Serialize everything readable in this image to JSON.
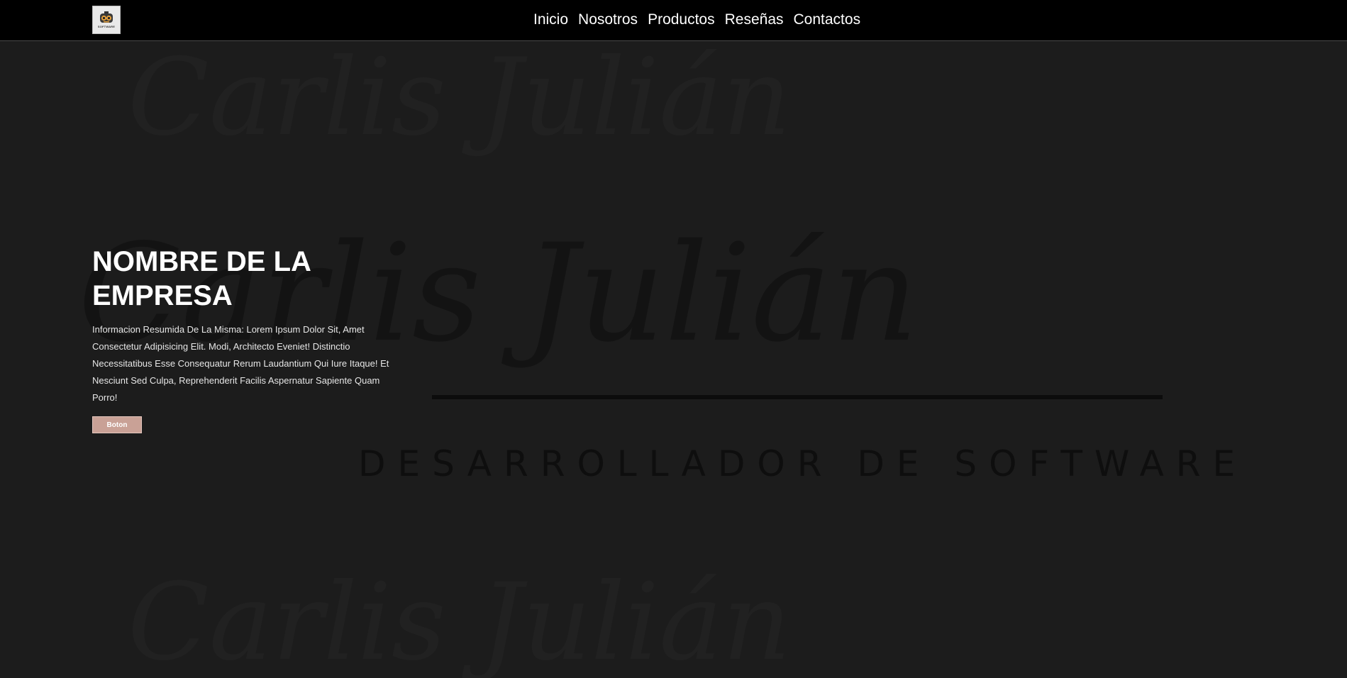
{
  "header": {
    "logo_alt": "SOFTWARE",
    "nav": [
      {
        "label": "Inicio"
      },
      {
        "label": "Nosotros"
      },
      {
        "label": "Productos"
      },
      {
        "label": "Reseñas"
      },
      {
        "label": "Contactos"
      }
    ]
  },
  "hero": {
    "title": "NOMBRE DE LA EMPRESA",
    "description": "Informacion Resumida De La Misma: Lorem Ipsum Dolor Sit, Amet Consectetur Adipisicing Elit. Modi, Architecto Eveniet! Distinctio Necessitatibus Esse Consequatur Rerum Laudantium Qui Iure Itaque! Et Nesciunt Sed Culpa, Reprehenderit Facilis Aspernatur Sapiente Quam Porro!",
    "button_label": "Boton",
    "watermark_signature": "Carlis Julián",
    "watermark_subtitle": "DESARROLLADOR DE SOFTWARE"
  },
  "colors": {
    "header_bg": "#000000",
    "hero_bg": "#1c1c1c",
    "button_bg": "#c9a196",
    "text": "#ffffff"
  }
}
